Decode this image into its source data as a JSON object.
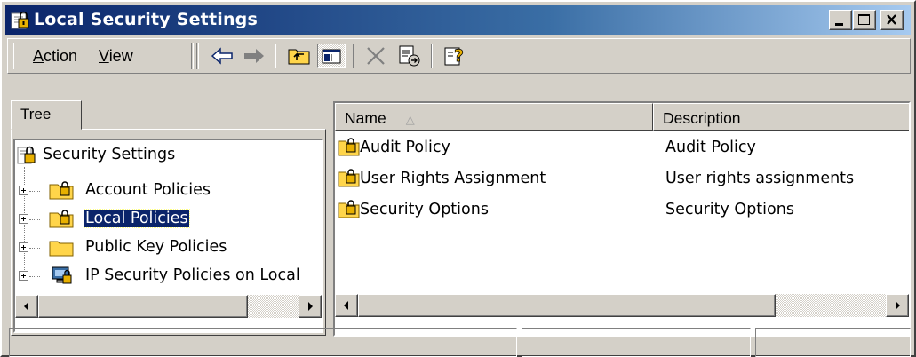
{
  "window": {
    "title": "Local Security Settings",
    "title_icon": "security-settings-icon",
    "controls": [
      "minimize-icon",
      "maximize-icon",
      "close-icon"
    ]
  },
  "menu": {
    "items": [
      {
        "label": "Action",
        "accel": "A"
      },
      {
        "label": "View",
        "accel": "V"
      }
    ]
  },
  "toolbar": {
    "buttons": [
      "back-arrow-icon",
      "forward-arrow-icon",
      "up-one-level-icon",
      "show-hide-tree-icon",
      "delete-icon",
      "export-list-icon",
      "help-icon"
    ]
  },
  "tree": {
    "tab_label": "Tree",
    "root_label": "Security Settings",
    "items": [
      {
        "label": "Account Policies",
        "icon": "locked-folder-icon",
        "selected": false
      },
      {
        "label": "Local Policies",
        "icon": "locked-folder-icon",
        "selected": true
      },
      {
        "label": "Public Key Policies",
        "icon": "folder-icon",
        "selected": false
      },
      {
        "label": "IP Security Policies on Local",
        "icon": "ip-security-icon",
        "selected": false
      }
    ]
  },
  "list": {
    "columns": [
      {
        "label": "Name",
        "sorted": "ascending"
      },
      {
        "label": "Description"
      }
    ],
    "rows": [
      {
        "name": "Audit Policy",
        "description": "Audit Policy",
        "icon": "locked-folder-icon"
      },
      {
        "name": "User Rights Assignment",
        "description": "User rights assignments",
        "icon": "locked-folder-icon"
      },
      {
        "name": "Security Options",
        "description": "Security Options",
        "icon": "locked-folder-icon"
      }
    ]
  },
  "colors": {
    "titlebar_start": "#0a246a",
    "titlebar_end": "#a6caf0",
    "face": "#d4d0c8",
    "selection": "#0a246a",
    "folder": "#ffd54a"
  }
}
